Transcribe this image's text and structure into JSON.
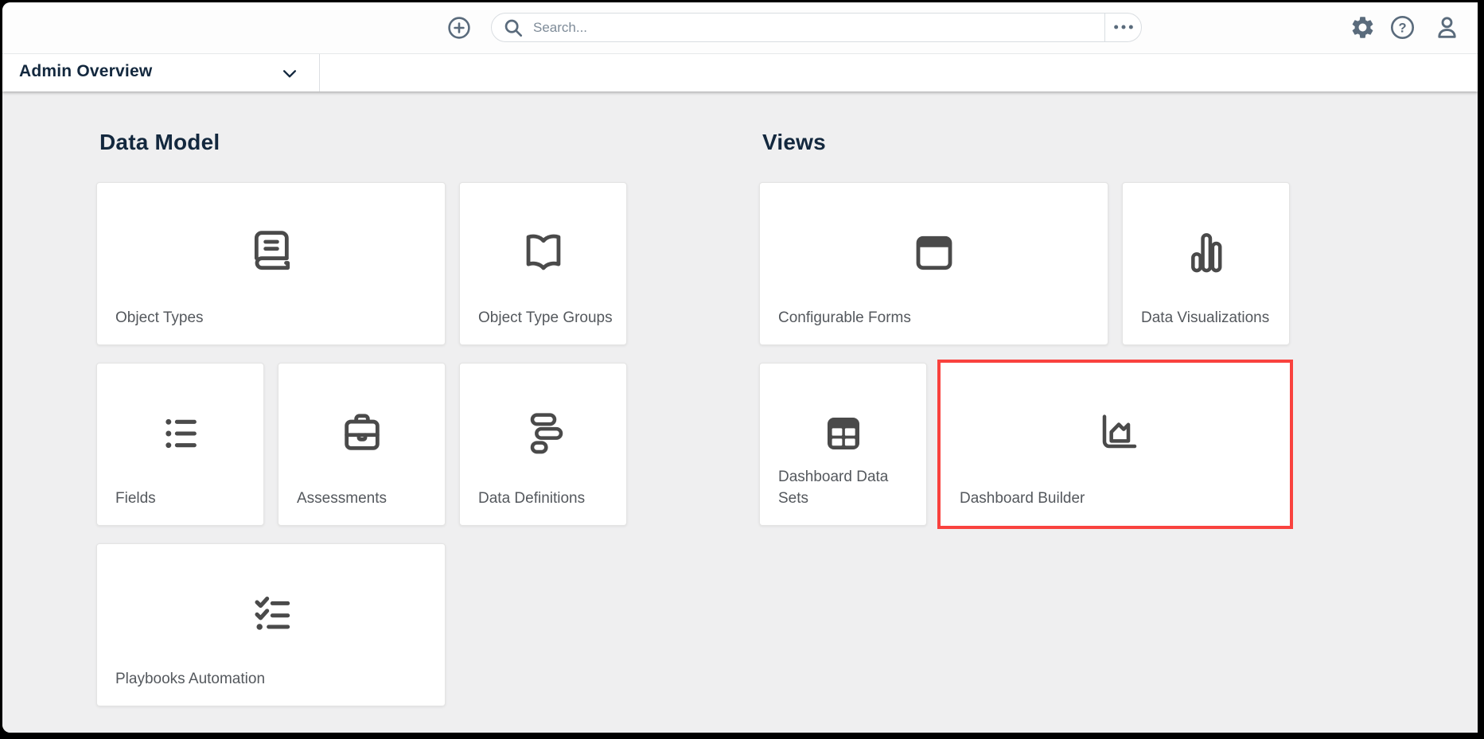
{
  "topbar": {
    "add_button": {
      "icon": "plus-circle-icon"
    },
    "search": {
      "placeholder": "Search...",
      "icon": "search-icon",
      "more_button_icon": "ellipsis-icon"
    },
    "right_buttons": [
      {
        "id": "settings",
        "icon": "settings-gear-icon"
      },
      {
        "id": "help",
        "icon": "help-question-icon"
      },
      {
        "id": "user",
        "icon": "user-profile-icon"
      }
    ]
  },
  "nav_bar": {
    "dropdown_label": "Admin Overview",
    "chevron_icon": "chevron-down-icon"
  },
  "sections": [
    {
      "title": "Data Model",
      "cards": [
        {
          "label": "Object Types",
          "icon": "book-icon",
          "span": 2
        },
        {
          "label": "Object Type Groups",
          "icon": "open-book-icon",
          "span": 1
        },
        {
          "label": "Fields",
          "icon": "bullet-list-icon",
          "span": 1
        },
        {
          "label": "Assessments",
          "icon": "briefcase-icon",
          "span": 1
        },
        {
          "label": "Data Definitions",
          "icon": "data-blocks-icon",
          "span": 1
        },
        {
          "label": "Playbooks Automation",
          "icon": "checklist-icon",
          "span": 2
        }
      ]
    },
    {
      "title": "Views",
      "cards": [
        {
          "label": "Configurable Forms",
          "icon": "window-icon",
          "span": 2
        },
        {
          "label": "Data Visualizations",
          "icon": "bar-chart-icon",
          "span": 1
        },
        {
          "label": "Dashboard Data Sets",
          "icon": "data-table-icon",
          "span": 1
        },
        {
          "label": "Dashboard Builder",
          "icon": "area-chart-icon",
          "span": 2,
          "highlighted": true
        }
      ]
    }
  ],
  "colors": {
    "highlight_red": "#f9423e",
    "heading_navy": "#13283e",
    "icon_dark_gray": "#4a4a4a",
    "topbar_slate": "#5a6b7c",
    "label_gray": "#54585d",
    "page_background": "#efeff0"
  }
}
